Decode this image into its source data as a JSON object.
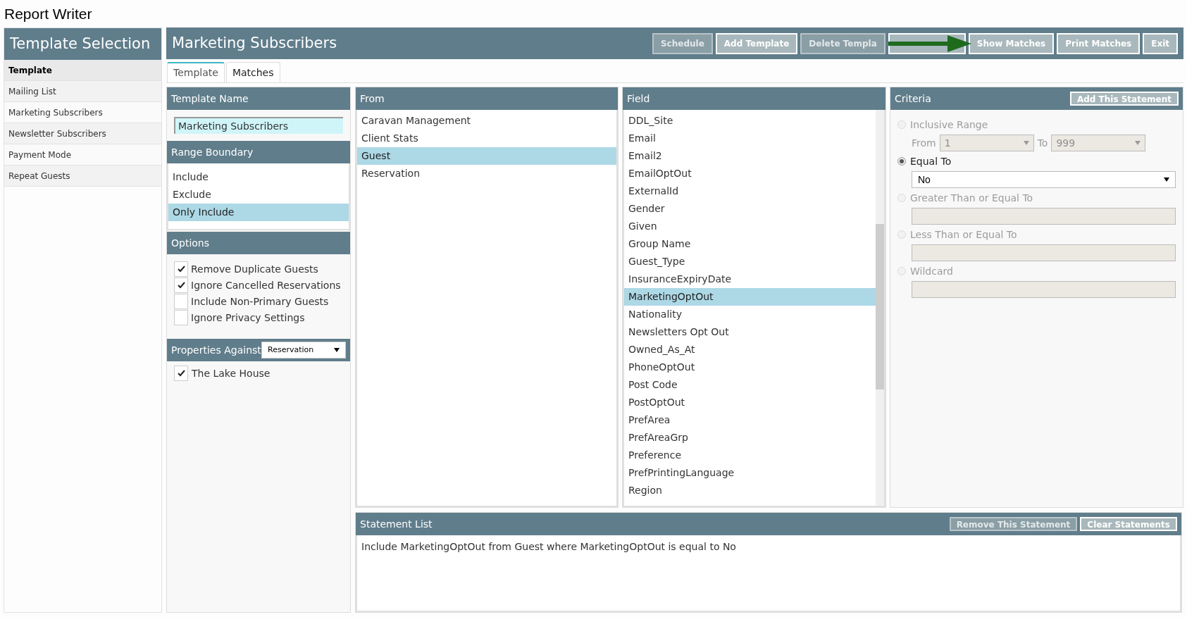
{
  "app_title": "Report Writer",
  "sidebar": {
    "title": "Template Selection",
    "items": [
      {
        "label": "Template",
        "selected": true
      },
      {
        "label": "Mailing List",
        "selected": false
      },
      {
        "label": "Marketing Subscribers",
        "selected": false
      },
      {
        "label": "Newsletter Subscribers",
        "selected": false
      },
      {
        "label": "Payment Mode",
        "selected": false
      },
      {
        "label": "Repeat Guests",
        "selected": false
      }
    ]
  },
  "main": {
    "title": "Marketing Subscribers",
    "toolbar": [
      {
        "label": "Schedule",
        "disabled": true
      },
      {
        "label": "Add Template",
        "disabled": false
      },
      {
        "label": "Delete Templa",
        "disabled": true
      },
      {
        "disabled": false
      },
      {
        "label": "Show Matches",
        "disabled": false
      },
      {
        "label": "Print Matches",
        "disabled": false
      },
      {
        "label": "Exit",
        "disabled": false
      }
    ]
  },
  "tabs": [
    {
      "label": "Template",
      "selected": true
    },
    {
      "label": "Matches",
      "selected": false
    }
  ],
  "template_name": {
    "heading": "Template Name",
    "value": "Marketing Subscribers"
  },
  "range_boundary": {
    "heading": "Range Boundary",
    "options": [
      {
        "label": "Include",
        "selected": false
      },
      {
        "label": "Exclude",
        "selected": false
      },
      {
        "label": "Only Include",
        "selected": true
      }
    ]
  },
  "options": {
    "heading": "Options",
    "items": [
      {
        "label": "Remove Duplicate Guests",
        "checked": true
      },
      {
        "label": "Ignore Cancelled Reservations",
        "checked": true
      },
      {
        "label": "Include Non-Primary Guests",
        "checked": false
      },
      {
        "label": "Ignore Privacy Settings",
        "checked": false
      }
    ]
  },
  "properties": {
    "heading": "Properties Against",
    "select": "Reservation",
    "items": [
      {
        "label": "The Lake House",
        "checked": true
      }
    ]
  },
  "from": {
    "heading": "From",
    "items": [
      {
        "label": "Caravan Management",
        "selected": false
      },
      {
        "label": "Client Stats",
        "selected": false
      },
      {
        "label": "Guest",
        "selected": true
      },
      {
        "label": "Reservation",
        "selected": false
      }
    ]
  },
  "field": {
    "heading": "Field",
    "items": [
      {
        "label": "DDL_Site",
        "selected": false
      },
      {
        "label": "Email",
        "selected": false
      },
      {
        "label": "Email2",
        "selected": false
      },
      {
        "label": "EmailOptOut",
        "selected": false
      },
      {
        "label": "ExternalId",
        "selected": false
      },
      {
        "label": "Gender",
        "selected": false
      },
      {
        "label": "Given",
        "selected": false
      },
      {
        "label": "Group Name",
        "selected": false
      },
      {
        "label": "Guest_Type",
        "selected": false
      },
      {
        "label": "InsuranceExpiryDate",
        "selected": false
      },
      {
        "label": "MarketingOptOut",
        "selected": true
      },
      {
        "label": "Nationality",
        "selected": false
      },
      {
        "label": "Newsletters Opt Out",
        "selected": false
      },
      {
        "label": "Owned_As_At",
        "selected": false
      },
      {
        "label": "PhoneOptOut",
        "selected": false
      },
      {
        "label": "Post Code",
        "selected": false
      },
      {
        "label": "PostOptOut",
        "selected": false
      },
      {
        "label": "PrefArea",
        "selected": false
      },
      {
        "label": "PrefAreaGrp",
        "selected": false
      },
      {
        "label": "Preference",
        "selected": false
      },
      {
        "label": "PrefPrintingLanguage",
        "selected": false
      },
      {
        "label": "Region",
        "selected": false
      }
    ]
  },
  "criteria": {
    "heading": "Criteria",
    "button": {
      "label": "Add This Statement",
      "disabled": false
    },
    "conditions": [
      {
        "kind": "range",
        "label": "Inclusive Range",
        "selected": false,
        "disabled": true,
        "from_label": "From",
        "from_value": "1",
        "to_label": "To",
        "to_value": "999"
      },
      {
        "kind": "select",
        "label": "Equal To",
        "selected": true,
        "disabled": false,
        "value": "No"
      },
      {
        "kind": "text",
        "label": "Greater Than or Equal To",
        "selected": false,
        "disabled": true
      },
      {
        "kind": "text",
        "label": "Less Than or Equal To",
        "selected": false,
        "disabled": true
      },
      {
        "kind": "text",
        "label": "Wildcard",
        "selected": false,
        "disabled": true
      }
    ]
  },
  "statement_list": {
    "heading": "Statement List",
    "buttons": [
      {
        "label": "Remove This Statement",
        "disabled": true
      },
      {
        "label": "Clear Statements",
        "disabled": false
      }
    ],
    "statements": [
      "Include MarketingOptOut from Guest where MarketingOptOut is equal to No"
    ]
  }
}
